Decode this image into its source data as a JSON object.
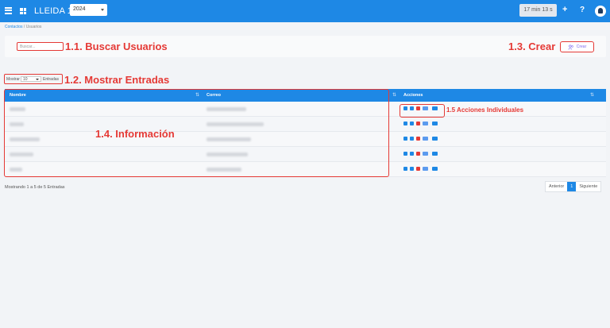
{
  "topbar": {
    "app_title": "LLEIDA 1",
    "year": "2024",
    "timer": "17 min 13 s",
    "plus": "+",
    "help": "?"
  },
  "breadcrumb": {
    "home": "Contactos",
    "separator": "/",
    "current": "Usuarios"
  },
  "search": {
    "placeholder": "Buscar..."
  },
  "create": {
    "label": "Crear"
  },
  "entries": {
    "show_label": "Mostrar",
    "value": "10",
    "entries_label": "Entradas"
  },
  "table": {
    "headers": [
      "Nombre",
      "Correo",
      "Acciones"
    ],
    "row_count": 5
  },
  "annotations": {
    "search": "1.1. Buscar Usuarios",
    "entries": "1.2. Mostrar Entradas",
    "create": "1.3. Crear",
    "info": "1.4. Información",
    "actions": "1.5 Acciones Individuales"
  },
  "footer": {
    "info": "Mostrando 1 a 5 de 5 Entradas"
  },
  "pagination": {
    "prev": "Anterior",
    "page": "1",
    "next": "Siguiente"
  },
  "colors": {
    "primary": "#1e88e5",
    "annotation": "#e53935"
  }
}
